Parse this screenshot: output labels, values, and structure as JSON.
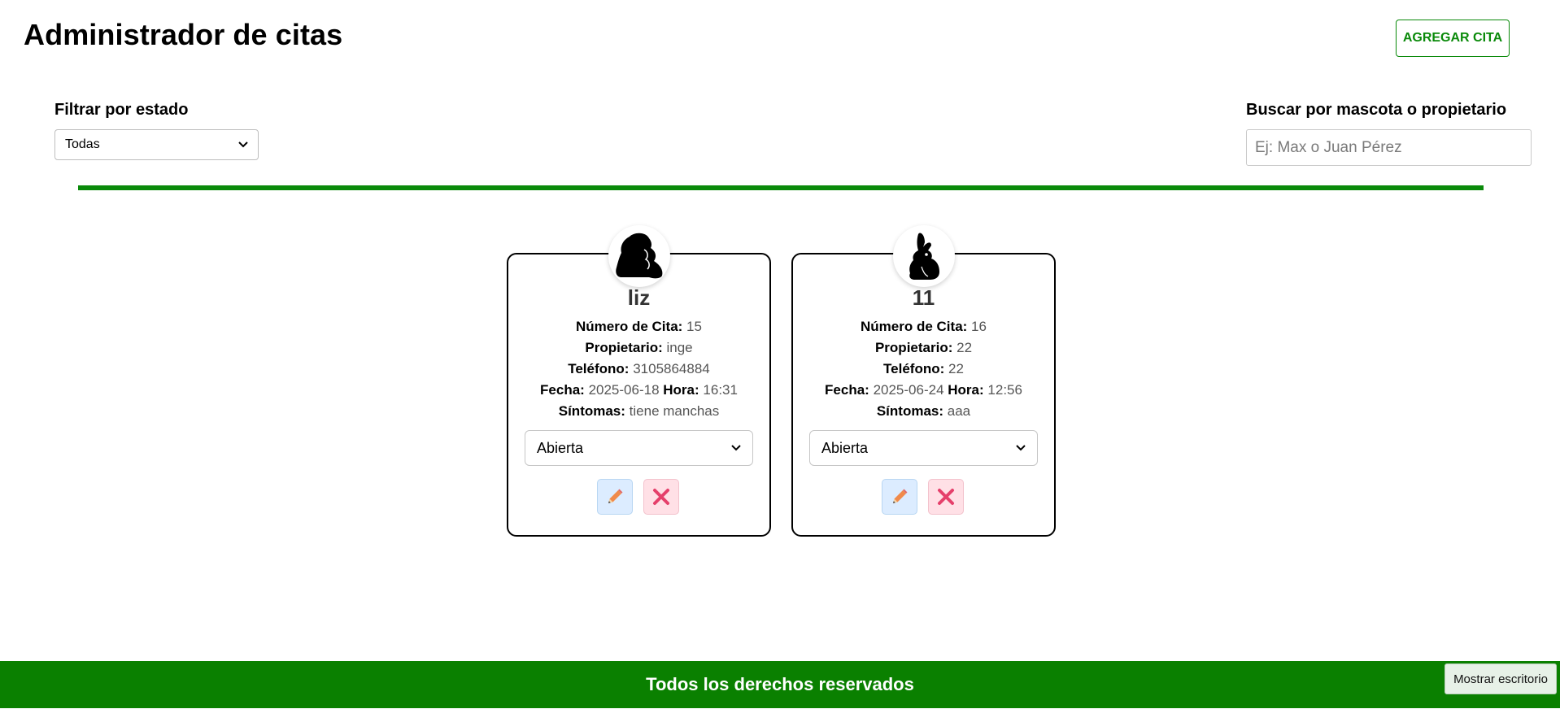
{
  "header": {
    "title": "Administrador de citas",
    "add_button": "AGREGAR CITA"
  },
  "filter": {
    "label": "Filtrar por estado",
    "selected": "Todas"
  },
  "search": {
    "label": "Buscar por mascota o propietario",
    "placeholder": "Ej: Max o Juan Pérez",
    "value": ""
  },
  "colors": {
    "accent": "#0a8a0a",
    "footer_bg": "#0a8000",
    "edit_bg": "#dcecff",
    "delete_bg": "#ffe0e6"
  },
  "labels": {
    "numero": "Número de Cita:",
    "propietario": "Propietario:",
    "telefono": "Teléfono:",
    "fecha": "Fecha:",
    "hora": "Hora:",
    "sintomas": "Síntomas:"
  },
  "cards": [
    {
      "icon": "bear-icon",
      "name": "liz",
      "numero": "15",
      "propietario": "inge",
      "telefono": "3105864884",
      "fecha": "2025-06-18",
      "hora": "16:31",
      "sintomas": "tiene manchas",
      "estado": "Abierta"
    },
    {
      "icon": "rabbit-icon",
      "name": "11",
      "numero": "16",
      "propietario": "22",
      "telefono": "22",
      "fecha": "2025-06-24",
      "hora": "12:56",
      "sintomas": "aaa",
      "estado": "Abierta"
    }
  ],
  "footer": {
    "text": "Todos los derechos reservados",
    "show_desktop": "Mostrar escritorio"
  }
}
